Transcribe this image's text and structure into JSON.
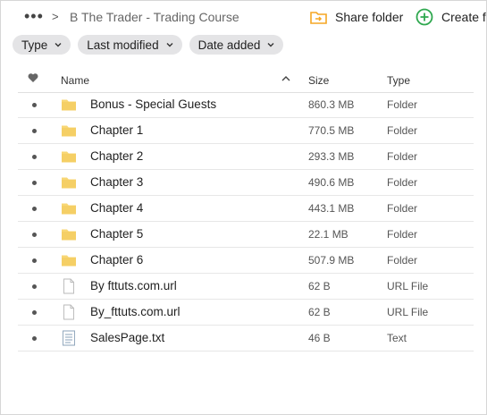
{
  "topbar": {
    "breadcrumb": "B The Trader - Trading Course",
    "share_label": "Share folder",
    "create_label": "Create fo"
  },
  "filters": [
    {
      "label": "Type"
    },
    {
      "label": "Last modified"
    },
    {
      "label": "Date added"
    }
  ],
  "table": {
    "columns": {
      "name": "Name",
      "size": "Size",
      "type": "Type"
    },
    "rows": [
      {
        "name": "Bonus - Special Guests",
        "size": "860.3 MB",
        "type": "Folder",
        "icon": "folder-icon"
      },
      {
        "name": "Chapter 1",
        "size": "770.5 MB",
        "type": "Folder",
        "icon": "folder-icon"
      },
      {
        "name": "Chapter 2",
        "size": "293.3 MB",
        "type": "Folder",
        "icon": "folder-icon"
      },
      {
        "name": "Chapter 3",
        "size": "490.6 MB",
        "type": "Folder",
        "icon": "folder-icon"
      },
      {
        "name": "Chapter 4",
        "size": "443.1 MB",
        "type": "Folder",
        "icon": "folder-icon"
      },
      {
        "name": "Chapter 5",
        "size": "22.1 MB",
        "type": "Folder",
        "icon": "folder-icon"
      },
      {
        "name": "Chapter 6",
        "size": "507.9 MB",
        "type": "Folder",
        "icon": "folder-icon"
      },
      {
        "name": "By fttuts.com.url",
        "size": "62 B",
        "type": "URL File",
        "icon": "file-icon"
      },
      {
        "name": "By_fttuts.com.url",
        "size": "62 B",
        "type": "URL File",
        "icon": "file-icon"
      },
      {
        "name": "SalesPage.txt",
        "size": "46 B",
        "type": "Text",
        "icon": "text-file-icon"
      }
    ]
  },
  "colors": {
    "folder": "#f8d775",
    "accent_green": "#2fa84f",
    "share_orange": "#f5a623"
  }
}
